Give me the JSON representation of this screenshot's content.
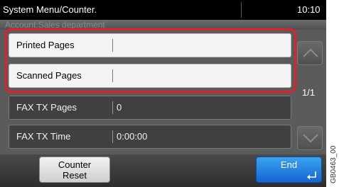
{
  "header": {
    "title": "System Menu/Counter.",
    "time": "10:10",
    "account": "Account:Sales department"
  },
  "rows": [
    {
      "label": "Printed Pages",
      "value": "",
      "state": "highlighted"
    },
    {
      "label": "Scanned Pages",
      "value": "",
      "state": "highlighted"
    },
    {
      "label": "FAX TX Pages",
      "value": "0",
      "state": "normal"
    },
    {
      "label": "FAX TX Time",
      "value": "0:00:00",
      "state": "normal"
    }
  ],
  "pager": {
    "text": "1/1"
  },
  "footer": {
    "counter_reset_line1": "Counter",
    "counter_reset_line2": "Reset",
    "end_label": "End"
  },
  "side_code": "GB0463_00",
  "colors": {
    "highlight": "#e0202a",
    "end_button": "#1f7ee0",
    "panel": "#5b5b5b"
  },
  "icons": [
    "scroll-up-icon",
    "scroll-down-icon",
    "enter-icon"
  ]
}
